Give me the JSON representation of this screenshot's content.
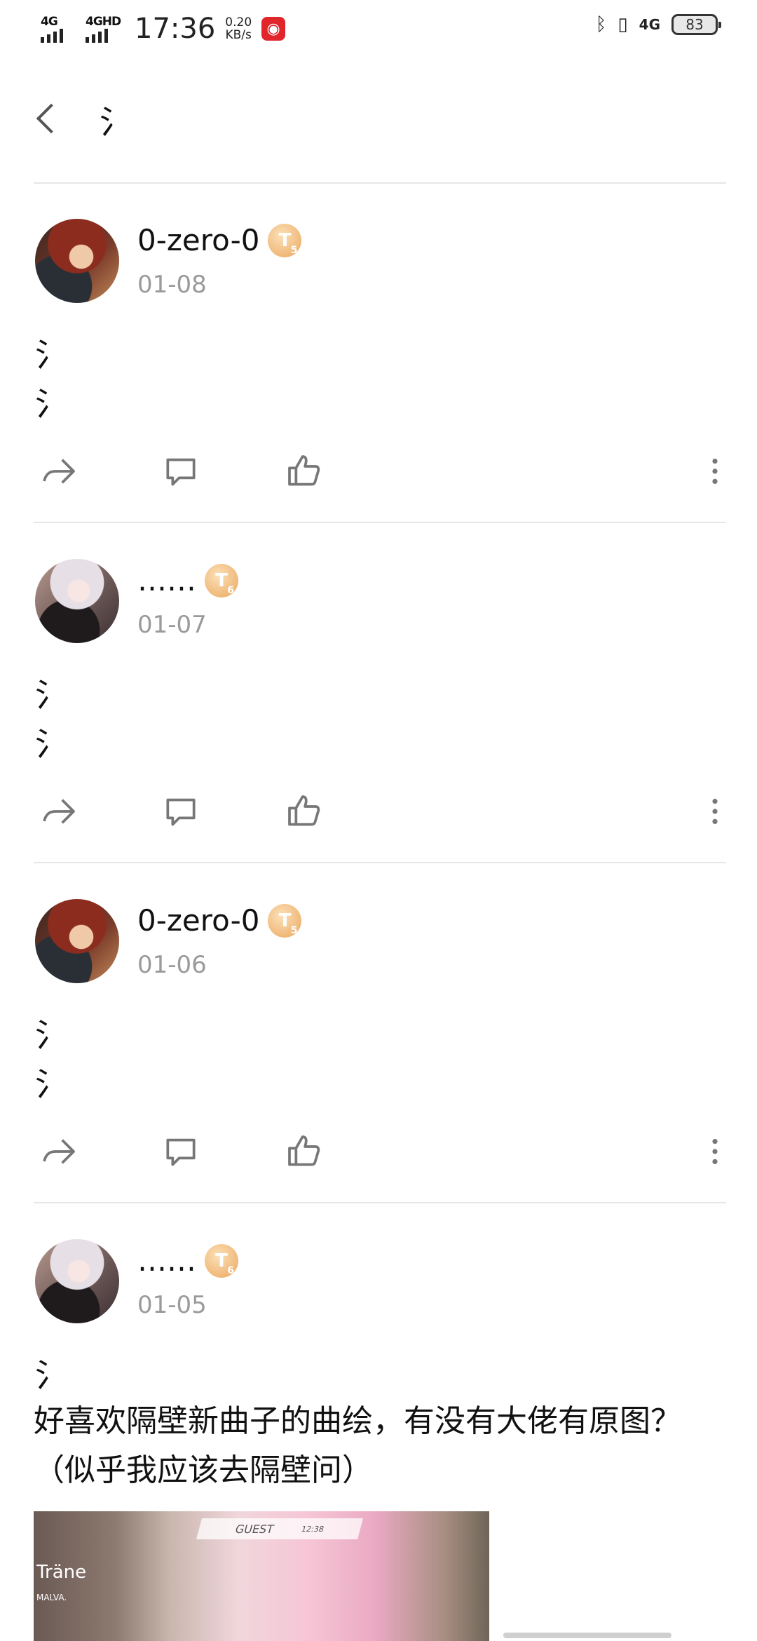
{
  "status_bar": {
    "signal1_label": "4G",
    "signal2_label": "4GHD",
    "time": "17:36",
    "speed_value": "0.20",
    "speed_unit": "KB/s",
    "battery": "83",
    "netease_icon": "netease-music-icon",
    "right_network_label": "4G"
  },
  "header": {
    "title": "氵"
  },
  "posts": [
    {
      "username": "0-zero-0",
      "badge_letter": "T",
      "badge_level": "5",
      "date": "01-08",
      "lines": [
        "氵",
        "氵"
      ]
    },
    {
      "username": "……",
      "badge_letter": "T",
      "badge_level": "6",
      "date": "01-07",
      "lines": [
        "氵",
        "氵"
      ]
    },
    {
      "username": "0-zero-0",
      "badge_letter": "T",
      "badge_level": "5",
      "date": "01-06",
      "lines": [
        "氵",
        "氵"
      ]
    },
    {
      "username": "……",
      "badge_letter": "T",
      "badge_level": "6",
      "date": "01-05",
      "lines": [
        "氵"
      ],
      "text": "好喜欢隔壁新曲子的曲绘，有没有大佬有原图？（似乎我应该去隔壁问）",
      "image": {
        "title": "Träne",
        "subtitle": "MALVA.",
        "guest_label": "GUEST",
        "guest_time": "12:38"
      }
    }
  ],
  "colors": {
    "badge": "#f0b878",
    "date_gray": "#9a9a9a",
    "icon_gray": "#777777",
    "divider": "#e6e6e6"
  }
}
